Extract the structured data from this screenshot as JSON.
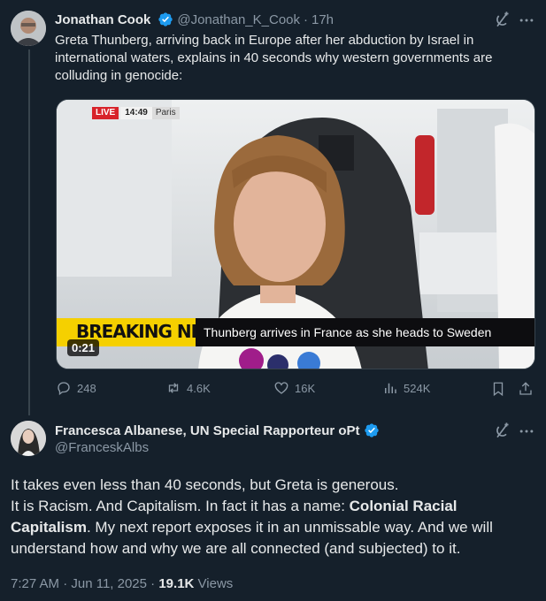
{
  "tweet1": {
    "author_name": "Jonathan Cook",
    "handle": "@Jonathan_K_Cook",
    "time": "17h",
    "text": "Greta Thunberg, arriving back in Europe after her abduction by Israel in international waters, explains in 40 seconds why western governments are colluding in genocide:",
    "video": {
      "live_label": "LIVE",
      "clock": "14:49",
      "location": "Paris",
      "breaking_label": "BREAKING NEWS",
      "ticker": "Thunberg arrives in France as she heads to Sweden",
      "duration": "0:21"
    },
    "stats": {
      "replies": "248",
      "reposts": "4.6K",
      "likes": "16K",
      "views": "524K"
    }
  },
  "tweet2": {
    "author_name": "Francesca Albanese, UN Special Rapporteur oPt",
    "handle": "@FranceskAlbs",
    "text_line1": "It takes even less than 40 seconds, but Greta is generous.",
    "text_line2_a": "It is Racism. And Capitalism. In fact it has a name: ",
    "text_line2_bold": "Colonial Racial Capitalism",
    "text_line2_b": ". My next report exposes it in an unmissable way. And we will understand how and why we are all connected (and subjected) to it.",
    "timestamp": "7:27 AM · Jun 11, 2025",
    "views_count": "19.1K",
    "views_label": "Views"
  },
  "colors": {
    "background": "#15202b",
    "verified": "#1d9bf0",
    "muted": "#8b98a5",
    "live_red": "#d8232a",
    "breaking_yellow": "#f5d000"
  }
}
